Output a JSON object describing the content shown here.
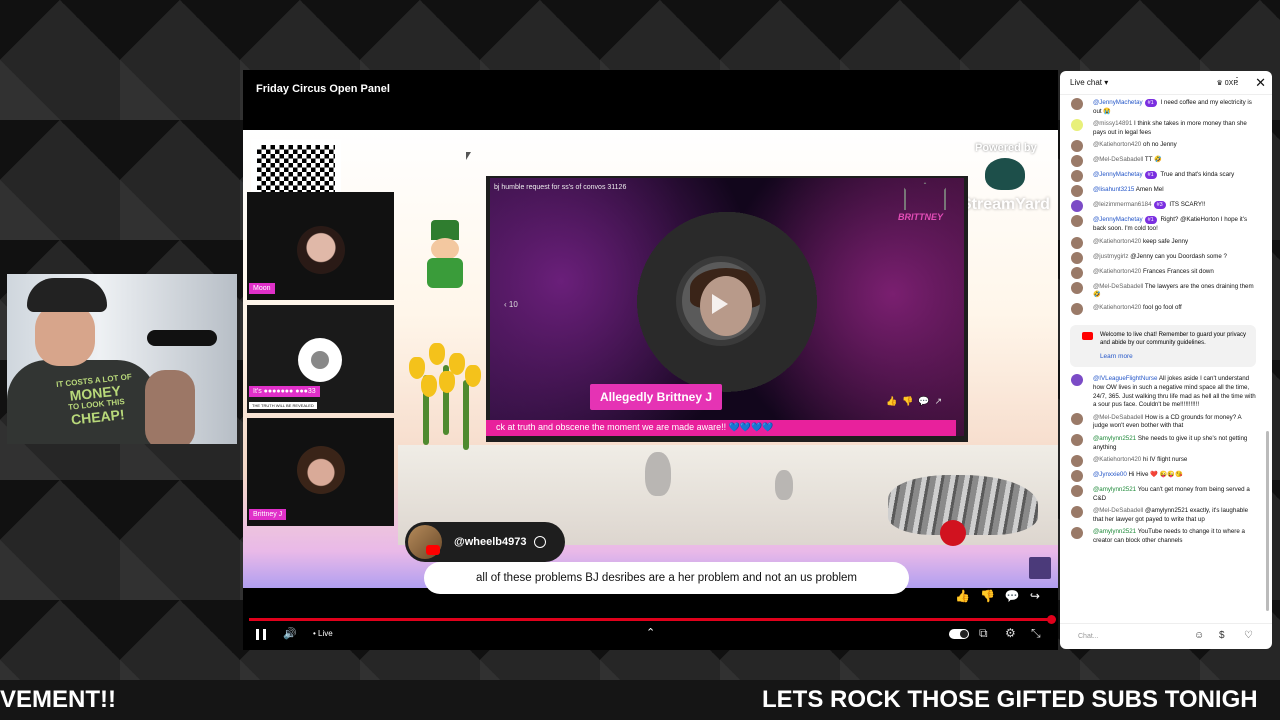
{
  "player": {
    "title": "Friday Circus Open Panel",
    "live_label": "• Live",
    "powered_by": "Powered by",
    "streamyard": "StreamYard"
  },
  "stage": {
    "guests": [
      {
        "name": "Moon"
      },
      {
        "name": "It's ●●●●●●● ●●●33",
        "subtitle": "THE TRUTH WILL BE REVEALED"
      },
      {
        "name": "Brittney J"
      }
    ],
    "inner_video_title": "bj humble request for ss's of convos 31126",
    "inner_brand": "BRITTNEY",
    "inner_timer": "10",
    "name_badge": "Allegedly Brittney J",
    "inner_ticker": "ck at truth and obscene the moment we are made aware!! 💙💙💙💙",
    "commenter_handle": "@wheelb4973",
    "comment_text": "all of these problems BJ desribes are a her problem and not an us problem"
  },
  "webcam": {
    "shirt_line1": "IT COSTS A LOT OF",
    "shirt_line2": "MONEY",
    "shirt_line3": "TO LOOK THIS",
    "shirt_line4": "CHEAP!"
  },
  "chat": {
    "header": "Live chat",
    "xp": "0XP",
    "placeholder": "Chat...",
    "messages": [
      {
        "author": "@JennyMachetay",
        "badge": "#1",
        "text": "I need coffee and my electricity is out 😭",
        "role": "owner"
      },
      {
        "author": "@missy14891",
        "text": "I think she takes in more money than she pays out in legal fees",
        "role": "none",
        "pf": "green"
      },
      {
        "author": "@Katiehorton420",
        "text": "oh no Jenny",
        "role": "none"
      },
      {
        "author": "@Mel-DeSabadell",
        "text": "TT 🤣",
        "role": "none"
      },
      {
        "author": "@JennyMachetay",
        "badge": "#1",
        "text": "True and that's kinda scary",
        "role": "owner"
      },
      {
        "author": "@lisahunt3215",
        "text": "Amen Mel",
        "role": "owner"
      },
      {
        "author": "@leizimmerman6184",
        "badge": "#3",
        "text": "ITS SCARY!!",
        "role": "none",
        "pf": "purple"
      },
      {
        "author": "@JennyMachetay",
        "badge": "#1",
        "text": "Right? @KatieHorton I hope it's back soon. I'm cold too!",
        "role": "owner"
      },
      {
        "author": "@Katiehorton420",
        "text": "keep safe Jenny",
        "role": "none"
      },
      {
        "author": "@justmygirlz",
        "text": "@Jenny can you Doordash some ?",
        "role": "none"
      },
      {
        "author": "@Katiehorton420",
        "text": "Frances Frances sit down",
        "role": "none"
      },
      {
        "author": "@Mel-DeSabadell",
        "text": "The lawyers are the ones draining them 🤣",
        "role": "none"
      },
      {
        "author": "@Katiehorton420",
        "text": "fool go fool off",
        "role": "none"
      }
    ],
    "welcome_text": "Welcome to live chat! Remember to guard your privacy and abide by our community guidelines.",
    "learn_more": "Learn more",
    "messages2": [
      {
        "author": "@IVLeagueFlightNurse",
        "text": "All jokes aside I can't understand how OW lives in such a negative mind space all the time, 24/7, 365. Just walking thru life mad as hell all the time with a sour pus face. Couldn't be me!!!!!!!!!!!",
        "role": "owner",
        "pf": "purple"
      },
      {
        "author": "@Mel-DeSabadell",
        "text": "How is a CD grounds for money? A judge won't even bother with that",
        "role": "none"
      },
      {
        "author": "@amylynn2521",
        "text": "She needs to give it up she's not getting anything",
        "role": "member"
      },
      {
        "author": "@Katiehorton420",
        "text": "hi IV flight nurse",
        "role": "none"
      },
      {
        "author": "@Jynxxie00",
        "text": "Hi Hive ❤️ 😜😜😘",
        "role": "owner"
      },
      {
        "author": "@amylynn2521",
        "text": "You can't get money from being served a C&D",
        "role": "member"
      },
      {
        "author": "@Mel-DeSabadell",
        "text": "@amylynn2521 exactly, it's laughable that her lawyer got payed to write that up",
        "role": "none"
      },
      {
        "author": "@amylynn2521",
        "text": "YouTube needs to change it to where a creator can block other channels",
        "role": "member"
      }
    ]
  },
  "ticker": {
    "left": "VEMENT!!",
    "right": "LETS ROCK THOSE GIFTED SUBS TONIGH"
  }
}
